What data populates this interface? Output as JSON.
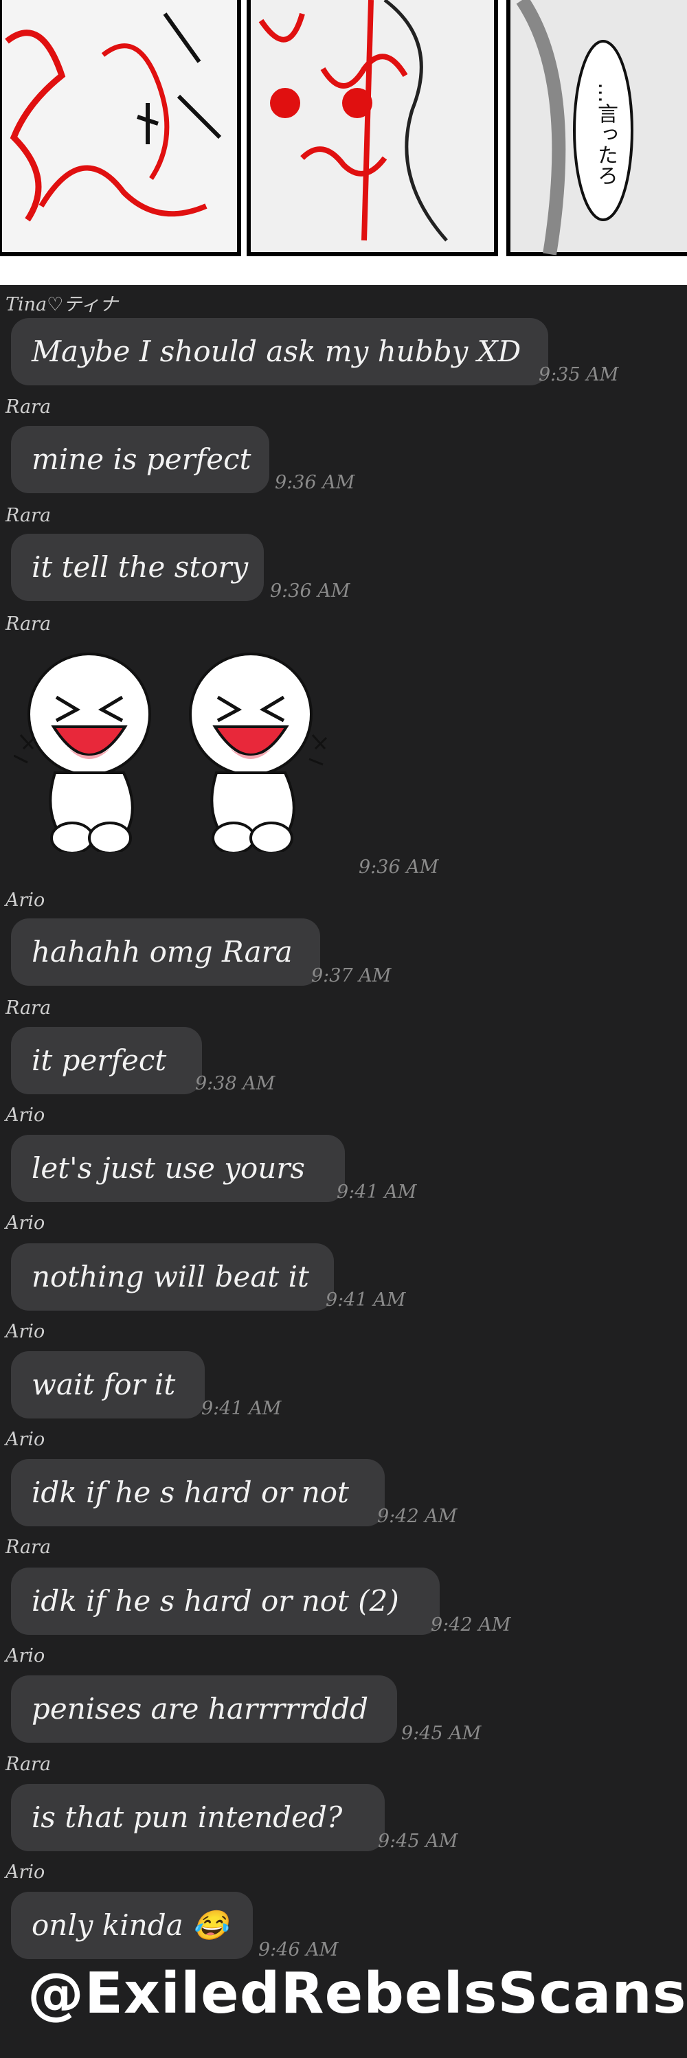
{
  "manga": {
    "speech_text": "…言ったろ"
  },
  "messages": [
    {
      "sender": "Tina♡ティナ",
      "text": "Maybe I should ask my hubby XD",
      "time": "9:35 AM"
    },
    {
      "sender": "Rara",
      "text": "mine is perfect",
      "time": "9:36 AM"
    },
    {
      "sender": "Rara",
      "text": "it tell the story",
      "time": "9:36 AM"
    },
    {
      "sender": "Rara",
      "sticker": "laughing-twins-sticker",
      "time": "9:36 AM"
    },
    {
      "sender": "Ario",
      "text": "hahahh omg Rara",
      "time": "9:37 AM"
    },
    {
      "sender": "Rara",
      "text": "it perfect",
      "time": "9:38 AM"
    },
    {
      "sender": "Ario",
      "text": "let's just use yours",
      "time": "9:41 AM"
    },
    {
      "sender": "Ario",
      "text": "nothing will beat it",
      "time": "9:41 AM"
    },
    {
      "sender": "Ario",
      "text": "wait for it",
      "time": "9:41 AM"
    },
    {
      "sender": "Ario",
      "text": "idk if he s hard or not",
      "time": "9:42 AM"
    },
    {
      "sender": "Rara",
      "text": "idk if he s hard or not (2)",
      "time": "9:42 AM"
    },
    {
      "sender": "Ario",
      "text": "penises are harrrrrddd",
      "time": "9:45 AM"
    },
    {
      "sender": "Rara",
      "text": "is that pun intended?",
      "time": "9:45 AM"
    },
    {
      "sender": "Ario",
      "text": "only kinda 😂",
      "time": "9:46 AM"
    }
  ],
  "watermark": "@ExiledRebelsScans",
  "colors": {
    "background": "#1f1f20",
    "bubble": "#3a3a3c",
    "manga_red": "#e01010"
  }
}
